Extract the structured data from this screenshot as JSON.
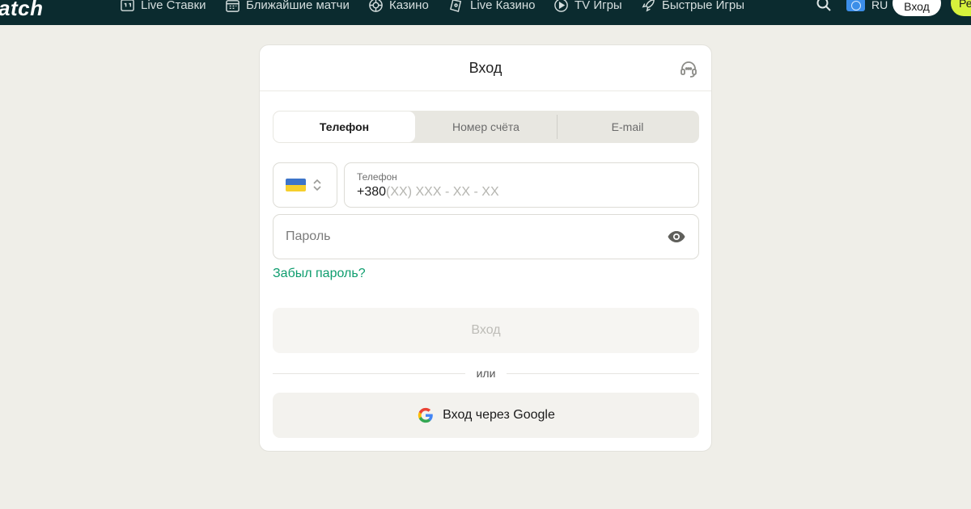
{
  "topbar": {
    "logo": "atch",
    "nav": [
      {
        "label": "Live Ставки",
        "icon": "score-board-icon"
      },
      {
        "label": "Ближайшие матчи",
        "icon": "calendar-icon"
      },
      {
        "label": "Казино",
        "icon": "casino-chip-icon"
      },
      {
        "label": "Live Казино",
        "icon": "live-casino-icon"
      },
      {
        "label": "TV Игры",
        "icon": "play-circle-icon"
      },
      {
        "label": "Быстрые Игры",
        "icon": "rocket-icon"
      }
    ],
    "search_icon": "search-icon",
    "lang": {
      "code": "RU",
      "icon": "globe-icon"
    },
    "login_label": "Вход",
    "register_label": "Ре"
  },
  "colors": {
    "topbar_bg": "#0b2b2f",
    "page_bg": "#efeee8",
    "accent_green": "#0e9d6e",
    "register_yellow": "#d7f23c",
    "flag_blue": "#3d74c9",
    "flag_yellow": "#f6cf2c"
  },
  "modal": {
    "title": "Вход",
    "support_icon": "headset-icon",
    "tabs": [
      {
        "label": "Телефон",
        "active": true
      },
      {
        "label": "Номер счёта",
        "active": false
      },
      {
        "label": "E-mail",
        "active": false
      }
    ],
    "country": {
      "flag": "ukraine-flag-icon",
      "icon": "chevron-up-down-icon"
    },
    "phone": {
      "label": "Телефон",
      "prefix": "+380",
      "mask": "(XX) XXX - XX - XX"
    },
    "password": {
      "placeholder": "Пароль",
      "icon": "eye-icon"
    },
    "forgot_label": "Забыл пароль?",
    "submit_label": "Вход",
    "or_label": "или",
    "google_label": "Вход через Google",
    "google_icon": "google-icon"
  }
}
